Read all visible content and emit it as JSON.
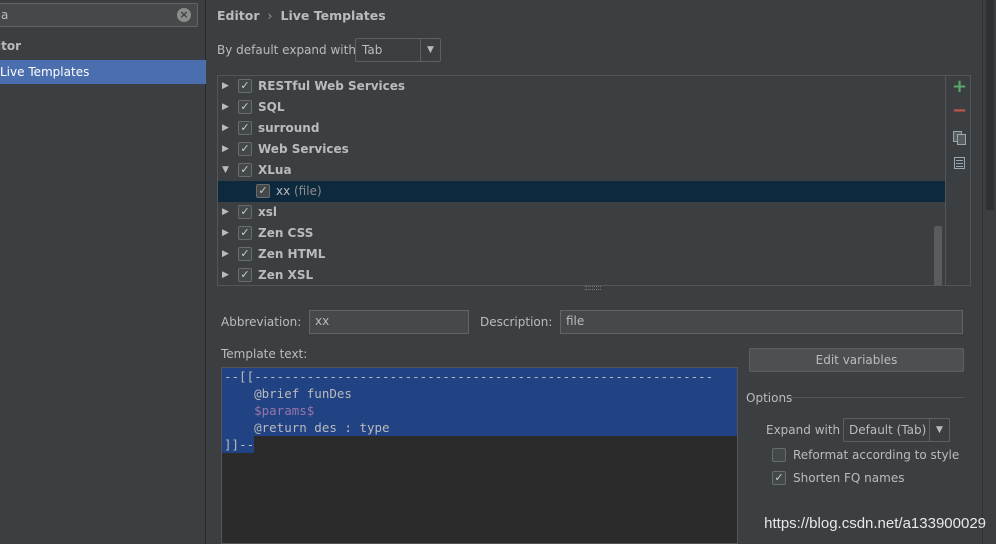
{
  "search": {
    "value": "a"
  },
  "nav": {
    "section": "itor",
    "selected": "Live Templates"
  },
  "breadcrumb": {
    "root": "Editor",
    "separator": "›",
    "current": "Live Templates"
  },
  "expand_default": {
    "label": "By default expand with",
    "value": "Tab"
  },
  "tree": {
    "items": [
      {
        "label": "RESTful Web Services",
        "expanded": false,
        "checked": true
      },
      {
        "label": "SQL",
        "expanded": false,
        "checked": true
      },
      {
        "label": "surround",
        "expanded": false,
        "checked": true
      },
      {
        "label": "Web Services",
        "expanded": false,
        "checked": true
      },
      {
        "label": "XLua",
        "expanded": true,
        "checked": true
      },
      {
        "label": "xx",
        "suffix": "(file)",
        "child": true,
        "checked": true,
        "selected": true
      },
      {
        "label": "xsl",
        "expanded": false,
        "checked": true
      },
      {
        "label": "Zen CSS",
        "expanded": false,
        "checked": true
      },
      {
        "label": "Zen HTML",
        "expanded": false,
        "checked": true
      },
      {
        "label": "Zen XSL",
        "expanded": false,
        "checked": true
      }
    ]
  },
  "fields": {
    "abbreviation_label": "Abbreviation:",
    "abbreviation_value": "xx",
    "description_label": "Description:",
    "description_value": "file"
  },
  "template": {
    "label": "Template text:",
    "lines": [
      "--[[-------------------------------------------------------------",
      "    @brief funDes",
      "    $params$",
      "    @return des : type",
      "]]--"
    ]
  },
  "buttons": {
    "edit_variables": "Edit variables"
  },
  "options": {
    "title": "Options",
    "expand_with_label": "Expand with",
    "expand_with_value": "Default (Tab)",
    "reformat_label": "Reformat according to style",
    "reformat_checked": false,
    "shorten_label": "Shorten FQ names",
    "shorten_checked": true
  },
  "watermark": "https://blog.csdn.net/a133900029",
  "colors": {
    "background": "#3c3f41",
    "selection": "#4b6eaf",
    "editor_bg": "#2b2b2b",
    "editor_selection": "#214283",
    "add": "#59a869",
    "remove": "#c75450"
  },
  "icons": [
    "clear-icon",
    "chevron-down-icon",
    "expand-arrow-icon",
    "add-icon",
    "remove-icon",
    "copy-icon",
    "list-icon"
  ]
}
